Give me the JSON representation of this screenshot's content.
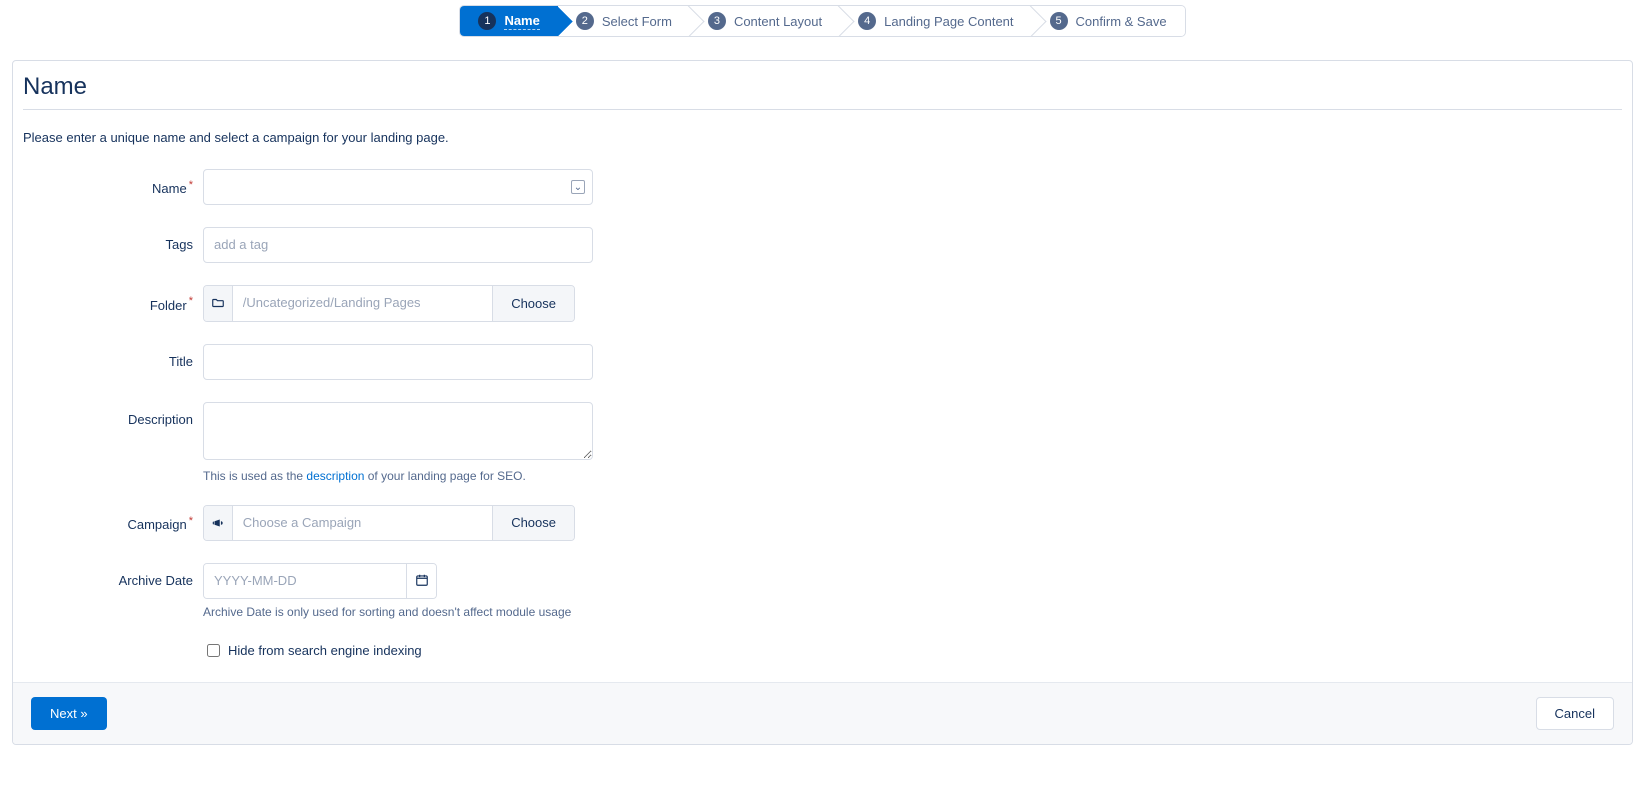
{
  "wizard": {
    "steps": [
      {
        "num": "1",
        "label": "Name"
      },
      {
        "num": "2",
        "label": "Select Form"
      },
      {
        "num": "3",
        "label": "Content Layout"
      },
      {
        "num": "4",
        "label": "Landing Page Content"
      },
      {
        "num": "5",
        "label": "Confirm & Save"
      }
    ]
  },
  "page": {
    "title": "Name",
    "intro": "Please enter a unique name and select a campaign for your landing page."
  },
  "form": {
    "name": {
      "label": "Name",
      "value": ""
    },
    "tags": {
      "label": "Tags",
      "placeholder": "add a tag",
      "value": ""
    },
    "folder": {
      "label": "Folder",
      "placeholder": "/Uncategorized/Landing Pages",
      "value": "",
      "choose": "Choose"
    },
    "title": {
      "label": "Title",
      "value": ""
    },
    "description": {
      "label": "Description",
      "value": "",
      "helper_prefix": "This is used as the ",
      "helper_link": "description",
      "helper_suffix": " of your landing page for SEO."
    },
    "campaign": {
      "label": "Campaign",
      "placeholder": "Choose a Campaign",
      "value": "",
      "choose": "Choose"
    },
    "archive": {
      "label": "Archive Date",
      "placeholder": "YYYY-MM-DD",
      "value": "",
      "helper": "Archive Date is only used for sorting and doesn't affect module usage"
    },
    "hide_index": {
      "label": "Hide from search engine indexing",
      "checked": false
    }
  },
  "footer": {
    "next": "Next »",
    "cancel": "Cancel"
  }
}
